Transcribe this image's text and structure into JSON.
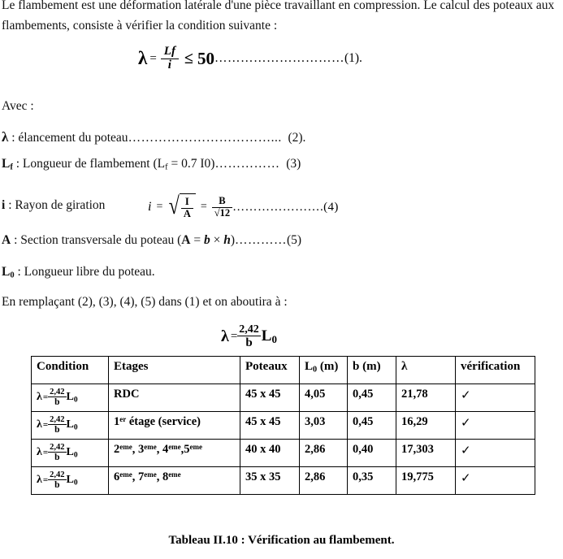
{
  "document": {
    "intro": "Le flambement est une déformation latérale d'une pièce travaillant en compression. Le calcul des poteaux aux flambements, consiste à vérifier la condition suivante :",
    "avec_label": "Avec :",
    "equation1": {
      "lambda": "λ",
      "equals": "=",
      "numerator": "Lf",
      "denominator": "i",
      "operator": "≤",
      "limit": "50",
      "dots": "…………………………",
      "ref": "(1)."
    },
    "definitions": [
      {
        "symbol": "λ",
        "text": " : élancement du poteau",
        "dots": "……………………………...",
        "ref": "(2)."
      },
      {
        "symbol": "Lf",
        "text": " : Longueur de flambement (Lf = 0.7 I0)",
        "dots": "……………",
        "ref": "(3)"
      },
      {
        "symbol": "i",
        "text": " : Rayon de giration",
        "dots": "…………………",
        "ref": "(4)"
      },
      {
        "symbol": "A",
        "text": " : Section transversale du poteau (A = b × h)",
        "dots": "…………",
        "ref": "(5)"
      },
      {
        "symbol": "L0",
        "text": " : Longueur libre du poteau.",
        "dots": "",
        "ref": ""
      }
    ],
    "equation4": {
      "variable": "i",
      "equals": "=",
      "radicand_num": "I",
      "radicand_den": "A",
      "equals2": "=",
      "result_num": "B",
      "result_den": "√12",
      "dots": "…………………."
    },
    "replacement_text": "En remplaçant (2), (3), (4), (5) dans (1) et on aboutira à :",
    "equation_lambda": {
      "lambda": "λ",
      "equals": "=",
      "numerator": "2,42",
      "denominator": "b",
      "factor": "L",
      "factor_sub": "0"
    }
  },
  "table": {
    "headers": [
      "Condition",
      "Etages",
      "Poteaux",
      "L0 (m)",
      "b (m)",
      "λ",
      "vérification"
    ],
    "header_parts": {
      "l0": {
        "base": "L",
        "sub": "0",
        "unit": " (m)"
      },
      "b": {
        "base": "b",
        "unit": " (m)"
      },
      "lambda": "λ"
    },
    "condition_formula": {
      "lambda": "λ",
      "equals": "=",
      "numerator": "2,42",
      "denominator": "b",
      "factor": "L",
      "factor_sub": "0"
    },
    "rows": [
      {
        "etages_parts": [
          {
            "base": "RDC",
            "sup": ""
          }
        ],
        "etages": "RDC",
        "poteaux": "45 x 45",
        "l0": "4,05",
        "b": "0,45",
        "lambda": "21,78",
        "verification": "✓"
      },
      {
        "etages_parts": [
          {
            "base": "1",
            "sup": "er",
            "after": " étage (service)"
          }
        ],
        "etages": "1er étage (service)",
        "poteaux": "45 x 45",
        "l0": "3,03",
        "b": "0,45",
        "lambda": "16,29",
        "verification": "✓"
      },
      {
        "etages_parts": [
          {
            "base": "2",
            "sup": "eme",
            "after": ", "
          },
          {
            "base": "3",
            "sup": "eme",
            "after": ", "
          },
          {
            "base": "4",
            "sup": "eme",
            "after": ","
          },
          {
            "base": "5",
            "sup": "eme",
            "after": ""
          }
        ],
        "etages": "2eme, 3eme, 4eme,5eme",
        "poteaux": "40 x 40",
        "l0": "2,86",
        "b": "0,40",
        "lambda": "17,303",
        "verification": "✓"
      },
      {
        "etages_parts": [
          {
            "base": "6",
            "sup": "eme",
            "after": ", "
          },
          {
            "base": "7",
            "sup": "eme",
            "after": ", "
          },
          {
            "base": "8",
            "sup": "eme",
            "after": ""
          }
        ],
        "etages": "6eme, 7eme, 8eme",
        "poteaux": "35 x 35",
        "l0": "2,86",
        "b": "0,35",
        "lambda": "19,775",
        "verification": "✓"
      }
    ]
  },
  "caption": "Tableau II.10 : Vérification au flambement."
}
